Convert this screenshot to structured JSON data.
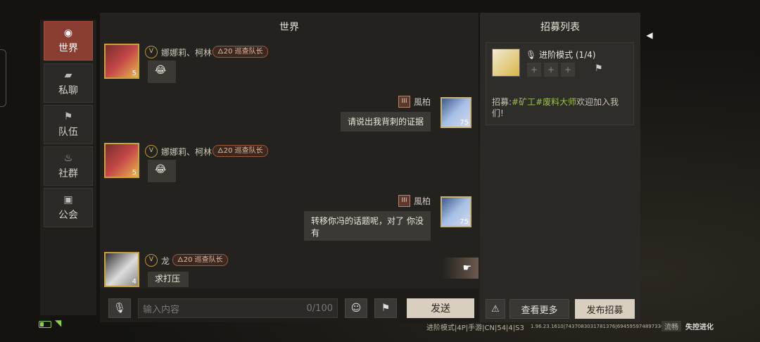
{
  "nav": {
    "items": [
      {
        "label": "世界",
        "icon": "globe-icon",
        "glyph": "◉",
        "active": true
      },
      {
        "label": "私聊",
        "icon": "chat-bubble-icon",
        "glyph": "▰"
      },
      {
        "label": "队伍",
        "icon": "flag-icon",
        "glyph": "⚑"
      },
      {
        "label": "社群",
        "icon": "campfire-icon",
        "glyph": "♨"
      },
      {
        "label": "公会",
        "icon": "banner-icon",
        "glyph": "▣"
      }
    ]
  },
  "chat": {
    "title": "世界",
    "messages": [
      {
        "side": "left",
        "name": "娜娜莉、柯林",
        "vip": "V",
        "tag": "🜂20 巡查队长",
        "level": "5",
        "text": "😂"
      },
      {
        "side": "right",
        "name": "風柏",
        "rank": "III",
        "level": "75",
        "text": "请说出我背刺的证据"
      },
      {
        "side": "left",
        "name": "娜娜莉、柯林",
        "vip": "V",
        "tag": "🜂20 巡查队长",
        "level": "5",
        "text": "😂"
      },
      {
        "side": "right",
        "name": "風柏",
        "rank": "III",
        "level": "75",
        "text": "转移你冯的话题呢，对了 你没有"
      },
      {
        "side": "left",
        "name": "龙",
        "vip": "V",
        "tag": "🜂20 巡查队长",
        "level": "4",
        "text": "求打压"
      }
    ]
  },
  "input": {
    "placeholder": "输入内容",
    "counter": "0/100",
    "send_label": "发送"
  },
  "recruit": {
    "title": "招募列表",
    "mode": "进阶模式 (1/4)",
    "desc_prefix": "招募:",
    "desc_tags": "#矿工#废料大师",
    "desc_suffix": "欢迎加入我们!",
    "view_more": "查看更多",
    "publish": "发布招募"
  },
  "status": {
    "server": "进阶模式|4P|手游|CN|54|4|S3",
    "build": "1.96.23.1610|7437083031781376|6945959748973363​4",
    "flow": "流畅",
    "logo": "失控进化"
  },
  "colors": {
    "accent": "#8a3e32",
    "highlight": "#9dbf4e"
  }
}
